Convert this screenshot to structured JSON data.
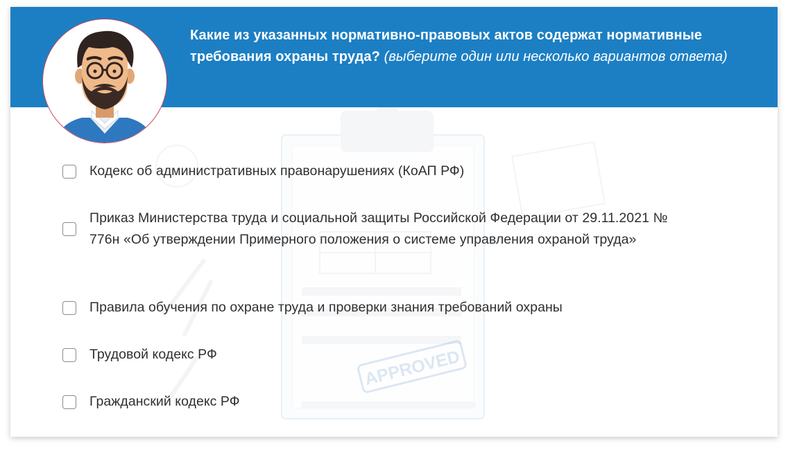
{
  "question": {
    "text_bold": "Какие из указанных нормативно-правовых актов содержат нормативные требования охраны труда?",
    "text_hint": "(выберите один или несколько вариантов ответа)"
  },
  "watermark": {
    "stamp_text": "APPROVED"
  },
  "options": [
    {
      "label": "Кодекс об административных правонарушениях (КоАП РФ)",
      "checked": false
    },
    {
      "label": "Приказ Министерства труда  и социальной защиты Российской Федерации от 29.11.2021 № 776н «Об утверждении Примерного положения о системе управления охраной труда»",
      "checked": false
    },
    {
      "label": "Правила обучения по охране труда  и проверки знания требований охраны",
      "checked": false
    },
    {
      "label": "Трудовой кодекс РФ",
      "checked": false
    },
    {
      "label": "Гражданский кодекс РФ",
      "checked": false
    }
  ],
  "colors": {
    "header_bg": "#1c7fc4",
    "header_text": "#ffffff",
    "option_text": "#2f2f2f",
    "checkbox_border": "#8c8c8c",
    "avatar_border": "#c4465a"
  }
}
